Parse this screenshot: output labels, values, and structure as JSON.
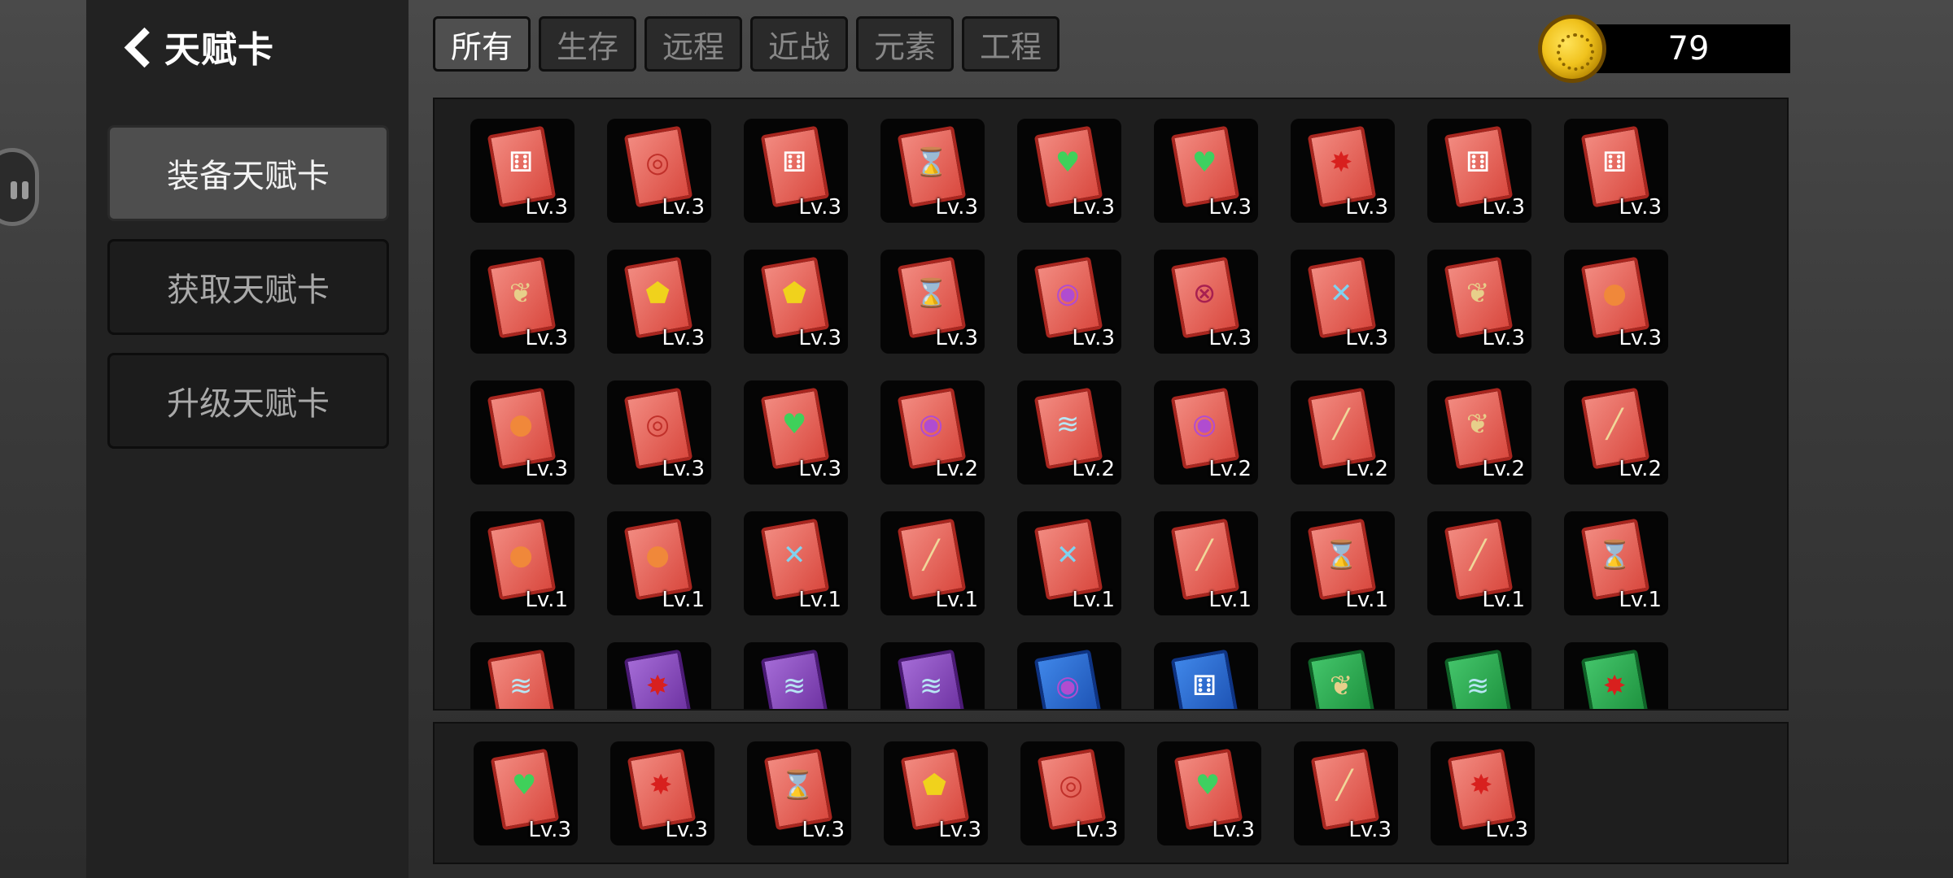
{
  "header": {
    "title": "天赋卡"
  },
  "sidebar": {
    "buttons": [
      {
        "label": "装备天赋卡",
        "active": true
      },
      {
        "label": "获取天赋卡",
        "active": false
      },
      {
        "label": "升级天赋卡",
        "active": false
      }
    ]
  },
  "tabs": [
    {
      "label": "所有",
      "active": true
    },
    {
      "label": "生存",
      "active": false
    },
    {
      "label": "远程",
      "active": false
    },
    {
      "label": "近战",
      "active": false
    },
    {
      "label": "元素",
      "active": false
    },
    {
      "label": "工程",
      "active": false
    }
  ],
  "currency": {
    "amount": "79"
  },
  "colors": {
    "red": "#e05a50",
    "purple": "#7b3cb0",
    "blue": "#2a62c8",
    "green": "#22a048"
  },
  "inventory": {
    "rows": [
      [
        {
          "icon": "dice-icon",
          "color": "red",
          "level": "Lv.3"
        },
        {
          "icon": "swirl-icon",
          "color": "red",
          "level": "Lv.3"
        },
        {
          "icon": "dice-icon",
          "color": "red",
          "level": "Lv.3"
        },
        {
          "icon": "hourglass-icon",
          "color": "red",
          "level": "Lv.3"
        },
        {
          "icon": "heart-plus-icon",
          "color": "red",
          "level": "Lv.3"
        },
        {
          "icon": "heart-icon",
          "color": "red",
          "level": "Lv.3"
        },
        {
          "icon": "starburst-icon",
          "color": "red",
          "level": "Lv.3"
        },
        {
          "icon": "dice-icon",
          "color": "red",
          "level": "Lv.3"
        },
        {
          "icon": "dice-icon",
          "color": "red",
          "level": "Lv.3"
        }
      ],
      [
        {
          "icon": "feather-icon",
          "color": "red",
          "level": "Lv.3"
        },
        {
          "icon": "shield-icon",
          "color": "red",
          "level": "Lv.3"
        },
        {
          "icon": "shield-icon",
          "color": "red",
          "level": "Lv.3"
        },
        {
          "icon": "hourglass-icon",
          "color": "red",
          "level": "Lv.3"
        },
        {
          "icon": "signal-icon",
          "color": "red",
          "level": "Lv.3"
        },
        {
          "icon": "crosshair-icon",
          "color": "red",
          "level": "Lv.3"
        },
        {
          "icon": "crossed-swords-icon",
          "color": "red",
          "level": "Lv.3"
        },
        {
          "icon": "feather-icon",
          "color": "red",
          "level": "Lv.3"
        },
        {
          "icon": "flame-icon",
          "color": "red",
          "level": "Lv.3"
        }
      ],
      [
        {
          "icon": "flame-icon",
          "color": "red",
          "level": "Lv.3"
        },
        {
          "icon": "swirl-icon",
          "color": "red",
          "level": "Lv.3"
        },
        {
          "icon": "heart-plus-icon",
          "color": "red",
          "level": "Lv.3"
        },
        {
          "icon": "signal-icon",
          "color": "red",
          "level": "Lv.2"
        },
        {
          "icon": "dash-icon",
          "color": "red",
          "level": "Lv.2"
        },
        {
          "icon": "signal-icon",
          "color": "red",
          "level": "Lv.2"
        },
        {
          "icon": "sword-icon",
          "color": "red",
          "level": "Lv.2"
        },
        {
          "icon": "feather-icon",
          "color": "red",
          "level": "Lv.2"
        },
        {
          "icon": "sword-icon",
          "color": "red",
          "level": "Lv.2"
        }
      ],
      [
        {
          "icon": "flame-icon",
          "color": "red",
          "level": "Lv.1"
        },
        {
          "icon": "flame-icon",
          "color": "red",
          "level": "Lv.1"
        },
        {
          "icon": "crossed-swords-icon",
          "color": "red",
          "level": "Lv.1"
        },
        {
          "icon": "sword-icon",
          "color": "red",
          "level": "Lv.1"
        },
        {
          "icon": "crossed-swords-icon",
          "color": "red",
          "level": "Lv.1"
        },
        {
          "icon": "sword-icon",
          "color": "red",
          "level": "Lv.1"
        },
        {
          "icon": "hourglass-icon",
          "color": "red",
          "level": "Lv.1"
        },
        {
          "icon": "sword-icon",
          "color": "red",
          "level": "Lv.1"
        },
        {
          "icon": "hourglass-icon",
          "color": "red",
          "level": "Lv.1"
        }
      ],
      [
        {
          "icon": "dash-icon",
          "color": "red",
          "level": ""
        },
        {
          "icon": "starburst-icon",
          "color": "purple",
          "level": ""
        },
        {
          "icon": "dash-icon",
          "color": "purple",
          "level": ""
        },
        {
          "icon": "dash-icon",
          "color": "purple",
          "level": ""
        },
        {
          "icon": "signal-icon",
          "color": "blue",
          "level": ""
        },
        {
          "icon": "dice-icon",
          "color": "blue",
          "level": ""
        },
        {
          "icon": "feather-icon",
          "color": "green",
          "level": ""
        },
        {
          "icon": "dash-icon",
          "color": "green",
          "level": ""
        },
        {
          "icon": "starburst-icon",
          "color": "green",
          "level": ""
        }
      ]
    ]
  },
  "equipped": [
    {
      "icon": "heart-plus-icon",
      "color": "red",
      "level": "Lv.3"
    },
    {
      "icon": "starburst-icon",
      "color": "red",
      "level": "Lv.3"
    },
    {
      "icon": "hourglass-icon",
      "color": "red",
      "level": "Lv.3"
    },
    {
      "icon": "shield-icon",
      "color": "red",
      "level": "Lv.3"
    },
    {
      "icon": "swirl-icon",
      "color": "red",
      "level": "Lv.3"
    },
    {
      "icon": "heart-icon",
      "color": "red",
      "level": "Lv.3"
    },
    {
      "icon": "sword-icon",
      "color": "red",
      "level": "Lv.3"
    },
    {
      "icon": "starburst-icon",
      "color": "red",
      "level": "Lv.3"
    }
  ]
}
